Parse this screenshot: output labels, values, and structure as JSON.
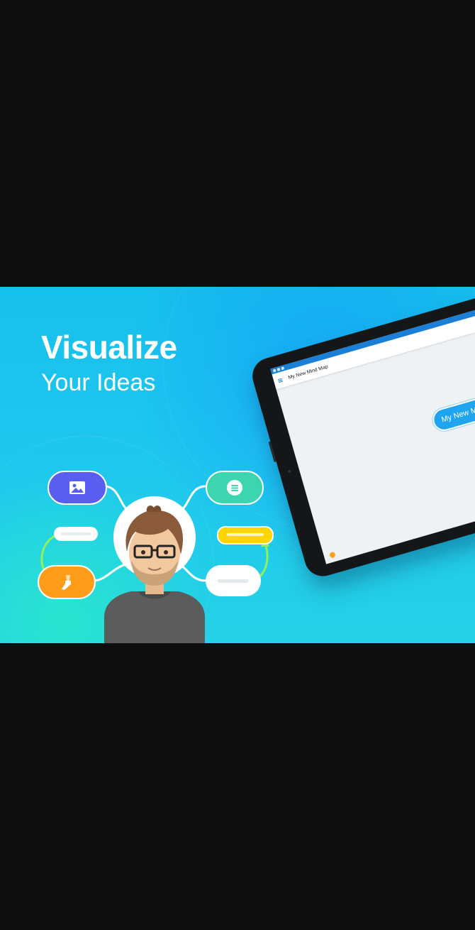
{
  "banner": {
    "headline": "Visualize",
    "subline": "Your Ideas"
  },
  "tablet": {
    "app_title": "My New Mind Map",
    "central_node_label": "My New Mind Map",
    "status_icons": [
      "wifi-icon",
      "battery-icon",
      "signal-icon"
    ],
    "toolbar_icons": [
      "brush-icon",
      "image-icon",
      "list-icon"
    ]
  },
  "mind_map": {
    "nodes": [
      {
        "name": "image-node",
        "icon": "image-icon",
        "color": "#5a5ef0"
      },
      {
        "name": "text-node",
        "icon": "text-lines-icon",
        "color": "#3bd6b0"
      },
      {
        "name": "style-node",
        "icon": "brush-icon",
        "color": "#ff9c19"
      },
      {
        "name": "highlight-node",
        "color": "#ffd500"
      }
    ]
  },
  "colors": {
    "background": "#0e0e0f",
    "banner_blue": "#16c0ec",
    "accent_green": "#3bd6b0",
    "accent_purple": "#5a5ef0",
    "accent_orange": "#ff9c19",
    "accent_yellow": "#ffd500",
    "app_blue": "#1a7fd6"
  }
}
